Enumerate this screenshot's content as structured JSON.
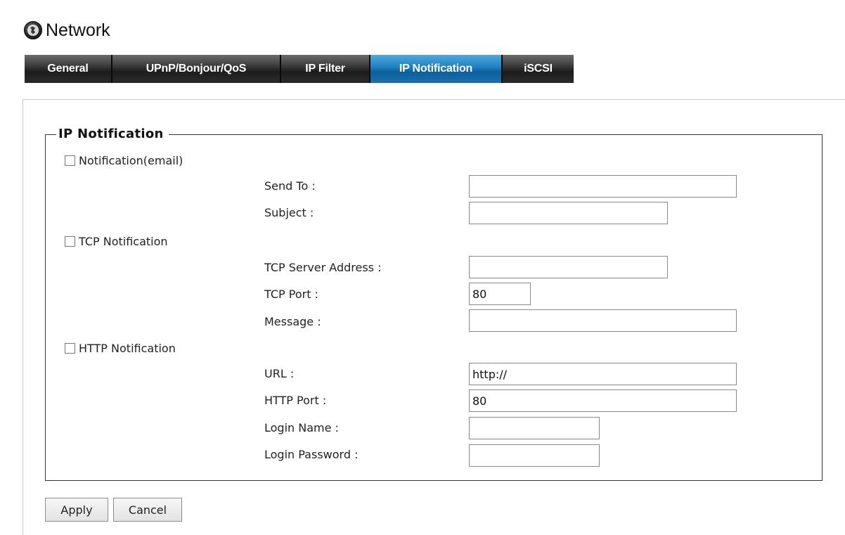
{
  "header": {
    "title": "Network",
    "icon": "network-globe-icon"
  },
  "tabs": [
    {
      "label": "General",
      "active": false
    },
    {
      "label": "UPnP/Bonjour/QoS",
      "active": false
    },
    {
      "label": "IP Filter",
      "active": false
    },
    {
      "label": "IP Notification",
      "active": true
    },
    {
      "label": "iSCSI",
      "active": false
    }
  ],
  "colors": {
    "active_tab": "#1d7fc2",
    "tab_bar": "#2b2b2b"
  },
  "ip_notification": {
    "legend": "IP Notification",
    "email": {
      "checkbox_label": "Notification(email)",
      "checked": false,
      "send_to_label": "Send To :",
      "send_to_value": "",
      "subject_label": "Subject :",
      "subject_value": ""
    },
    "tcp": {
      "checkbox_label": "TCP Notification",
      "checked": false,
      "server_label": "TCP Server Address :",
      "server_value": "",
      "port_label": "TCP Port :",
      "port_value": "80",
      "message_label": "Message :",
      "message_value": ""
    },
    "http": {
      "checkbox_label": "HTTP Notification",
      "checked": false,
      "url_label": "URL :",
      "url_value": "http://",
      "port_label": "HTTP Port :",
      "port_value": "80",
      "login_name_label": "Login Name :",
      "login_name_value": "",
      "login_password_label": "Login Password :",
      "login_password_value": ""
    }
  },
  "buttons": {
    "apply": "Apply",
    "cancel": "Cancel"
  }
}
